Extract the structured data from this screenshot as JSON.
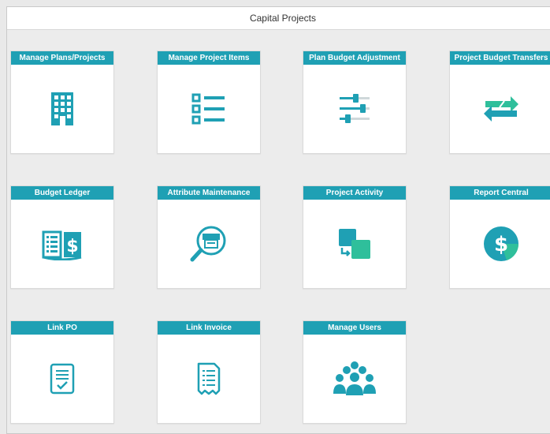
{
  "header": {
    "title": "Capital Projects"
  },
  "colors": {
    "accent": "#1fa0b4",
    "accent_dark": "#127c8c",
    "accent_light": "#2fbf9b"
  },
  "tiles": [
    {
      "label": "Manage Plans/Projects",
      "icon": "building-icon"
    },
    {
      "label": "Manage Project Items",
      "icon": "list-icon"
    },
    {
      "label": "Plan Budget Adjustment",
      "icon": "sliders-icon"
    },
    {
      "label": "Project Budget Transfers",
      "icon": "transfer-arrows-icon"
    },
    {
      "label": "Budget Ledger",
      "icon": "ledger-dollar-icon"
    },
    {
      "label": "Attribute Maintenance",
      "icon": "magnifier-icon"
    },
    {
      "label": "Project Activity",
      "icon": "activity-squares-icon"
    },
    {
      "label": "Report Central",
      "icon": "dollar-circle-icon"
    },
    {
      "label": "Link PO",
      "icon": "document-check-icon"
    },
    {
      "label": "Link Invoice",
      "icon": "receipt-icon"
    },
    {
      "label": "Manage Users",
      "icon": "users-group-icon"
    }
  ]
}
